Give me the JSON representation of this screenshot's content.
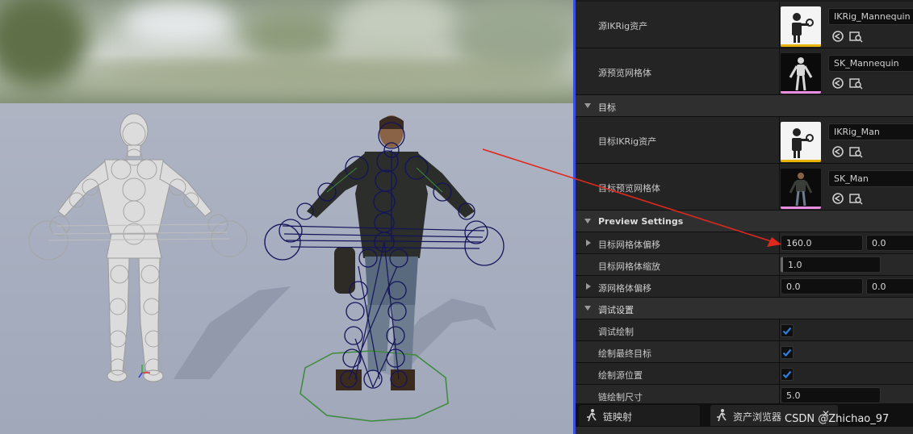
{
  "details": {
    "source_ikrig_label": "源IKRig资产",
    "source_ikrig_value": "IKRig_Mannequin",
    "source_mesh_label": "源预览网格体",
    "source_mesh_value": "SK_Mannequin",
    "target_section": "目标",
    "target_ikrig_label": "目标IKRig资产",
    "target_ikrig_value": "IKRig_Man",
    "target_mesh_label": "目标预览网格体",
    "target_mesh_value": "SK_Man",
    "preview_section": "Preview Settings",
    "target_offset_label": "目标网格体偏移",
    "target_offset_x": "160.0",
    "target_offset_y": "0.0",
    "target_scale_label": "目标网格体缩放",
    "target_scale_value": "1.0",
    "source_offset_label": "源网格体偏移",
    "source_offset_x": "0.0",
    "source_offset_y": "0.0",
    "debug_section": "调试设置",
    "debug_draw_label": "调试绘制",
    "draw_final_goal_label": "绘制最终目标",
    "draw_source_pos_label": "绘制源位置",
    "chain_draw_size_label": "链绘制尺寸",
    "chain_draw_size_value": "5.0"
  },
  "checks": {
    "debug_draw": true,
    "draw_final_goal": true,
    "draw_source_pos": true
  },
  "tabs": {
    "chain_mapping": "链映射",
    "asset_browser": "资产浏览器"
  },
  "watermark": "CSDN @Zhichao_97",
  "colors": {
    "accent": "#3a4fe0",
    "check": "#2f7fe0",
    "arrow": "#e0281c",
    "ikrig_underline": "#e7b400",
    "mesh_underline": "#e98de0",
    "bones": "#14145a",
    "ground_circle": "#3d8a3d"
  },
  "icons": {
    "ikrig_thumb": "ikrig-person-icon",
    "mesh_thumb": "skeletal-mesh-icon",
    "use": "use-selected-icon",
    "browse": "browse-asset-icon",
    "checkbox": "checkmark-icon",
    "tab": "running-person-icon",
    "close": "close-icon"
  }
}
